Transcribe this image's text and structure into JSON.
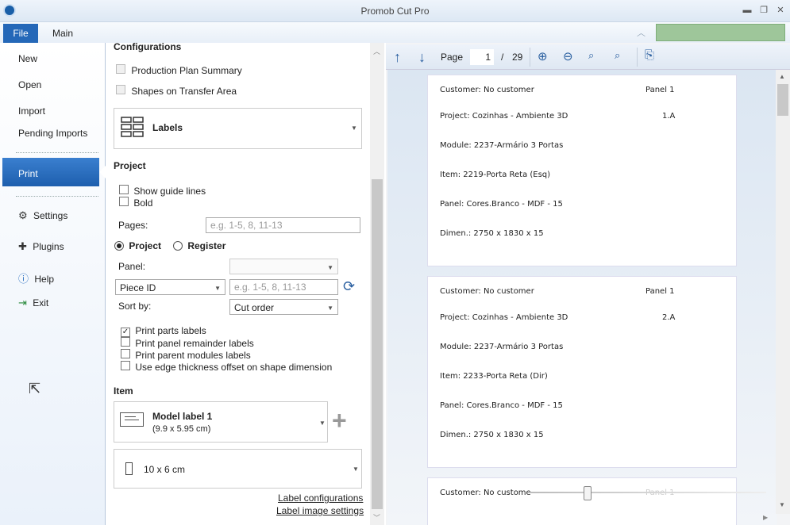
{
  "window": {
    "title": "Promob Cut Pro"
  },
  "menu": {
    "file_tab": "File",
    "main_tab": "Main"
  },
  "sidebar": {
    "items": [
      {
        "label": "New"
      },
      {
        "label": "Open"
      },
      {
        "label": "Import"
      },
      {
        "label": "Pending Imports"
      },
      {
        "label": "Print"
      },
      {
        "label": "Settings"
      },
      {
        "label": "Plugins"
      },
      {
        "label": "Help"
      },
      {
        "label": "Exit"
      }
    ]
  },
  "configurations": {
    "heading": "Configurations",
    "options": [
      {
        "label": "Production Plan Summary",
        "checked": false
      },
      {
        "label": "Shapes on Transfer Area",
        "checked": false
      }
    ],
    "layout_select": "Labels"
  },
  "project": {
    "heading": "Project",
    "show_guide_lines": "Show guide lines",
    "bold": "Bold",
    "pages_label": "Pages:",
    "pages_placeholder": "e.g. 1-5, 8, 11-13",
    "radio_project": "Project",
    "radio_register": "Register",
    "panel_label": "Panel:",
    "panel_value": "",
    "piece_select": "Piece ID",
    "piece_placeholder": "e.g. 1-5, 8, 11-13",
    "sort_by_label": "Sort by:",
    "sort_by_value": "Cut order",
    "checkboxes": [
      {
        "label": "Print parts labels",
        "checked": true
      },
      {
        "label": "Print panel remainder labels",
        "checked": false
      },
      {
        "label": "Print parent modules labels",
        "checked": false
      },
      {
        "label": "Use edge thickness offset on shape dimension",
        "checked": false
      }
    ]
  },
  "item": {
    "heading": "Item",
    "model_name": "Model label 1",
    "model_size": "(9.9 x 5.95 cm)",
    "paper_size": "10 x 6 cm",
    "link_configurations": "Label configurations",
    "link_image_settings": "Label image settings"
  },
  "preview_toolbar": {
    "page_label": "Page",
    "page_value": "1",
    "page_sep": "/",
    "page_total": "29"
  },
  "labels": [
    {
      "customer": "Customer: No customer",
      "panel": "Panel 1",
      "project": "Project: Cozinhas - Ambiente 3D",
      "code": "1.A",
      "module": "Module: 2237-Armário 3 Portas",
      "item": "Item: 2219-Porta Reta (Esq)",
      "panel_desc": "Panel: Cores.Branco - MDF - 15",
      "dimen": "Dimen.: 2750 x 1830 x 15"
    },
    {
      "customer": "Customer: No customer",
      "panel": "Panel 1",
      "project": "Project: Cozinhas - Ambiente 3D",
      "code": "2.A",
      "module": "Module: 2237-Armário 3 Portas",
      "item": "Item: 2233-Porta Reta (Dir)",
      "panel_desc": "Panel: Cores.Branco - MDF - 15",
      "dimen": "Dimen.: 2750 x 1830 x 15"
    },
    {
      "customer": "Customer: No custome",
      "panel": "Panel 1"
    }
  ]
}
